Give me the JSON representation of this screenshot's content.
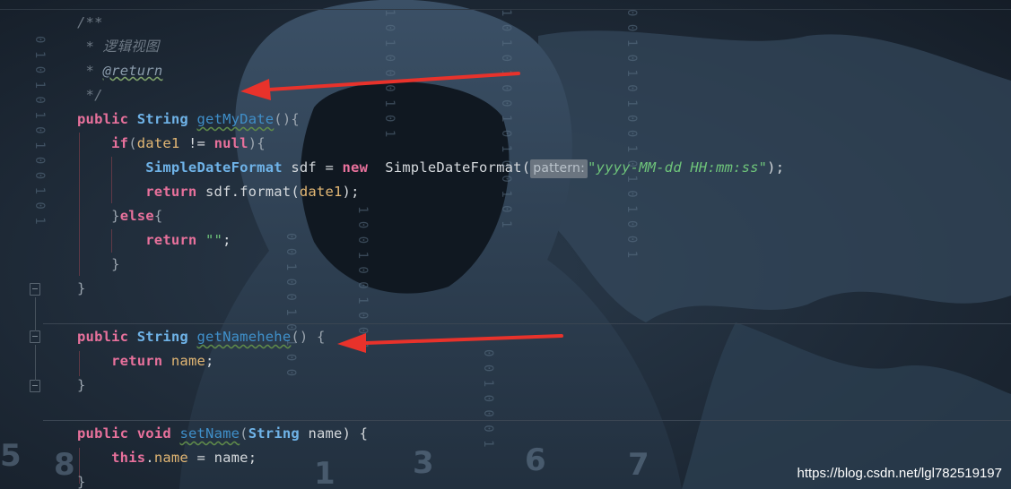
{
  "comment": {
    "open": "/**",
    "line1_star": "*",
    "line1_text": "逻辑视图",
    "line2_star": "*",
    "line2_tag": "@return",
    "close": "*/"
  },
  "method1": {
    "public": "public",
    "type": "String",
    "name": "getMyDate",
    "sig_tail": "(){",
    "if_kw": "if",
    "if_cond_open": "(",
    "if_var": "date1",
    "if_op": " != ",
    "if_null": "null",
    "if_cond_close": "){",
    "decl_type": "SimpleDateFormat",
    "decl_var": " sdf = ",
    "new_kw": "new",
    "ctor": "  SimpleDateFormat(",
    "hint": "pattern:",
    "pattern": "\"yyyy-MM-dd HH:mm:ss\"",
    "decl_end": ");",
    "return1_kw": "return",
    "return1_expr": " sdf.format(",
    "return1_var": "date1",
    "return1_end": ");",
    "else_close": "}",
    "else_kw": "else",
    "else_open": "{",
    "return2_kw": "return",
    "return2_val": "\"\"",
    "return2_end": ";",
    "inner_close": "}",
    "outer_close": "}"
  },
  "method2": {
    "public": "public",
    "type": "String",
    "name": "getNamehehe",
    "sig_tail": "() {",
    "return_kw": "return",
    "return_field": "name",
    "return_end": ";",
    "close": "}"
  },
  "method3": {
    "public": "public",
    "void": "void",
    "name": "setName",
    "param_open": "(",
    "param_type": "String",
    "param_name": " name) {",
    "this_kw": "this",
    "dot": ".",
    "field": "name",
    "assign": " = name;",
    "close": "}"
  },
  "watermark": "https://blog.csdn.net/lgl782519197",
  "colors": {
    "keyword": "#e8719c",
    "type": "#6fb3e8",
    "string": "#6ec47a",
    "field": "#e3b774",
    "annotation_arrow": "#e8322b"
  }
}
